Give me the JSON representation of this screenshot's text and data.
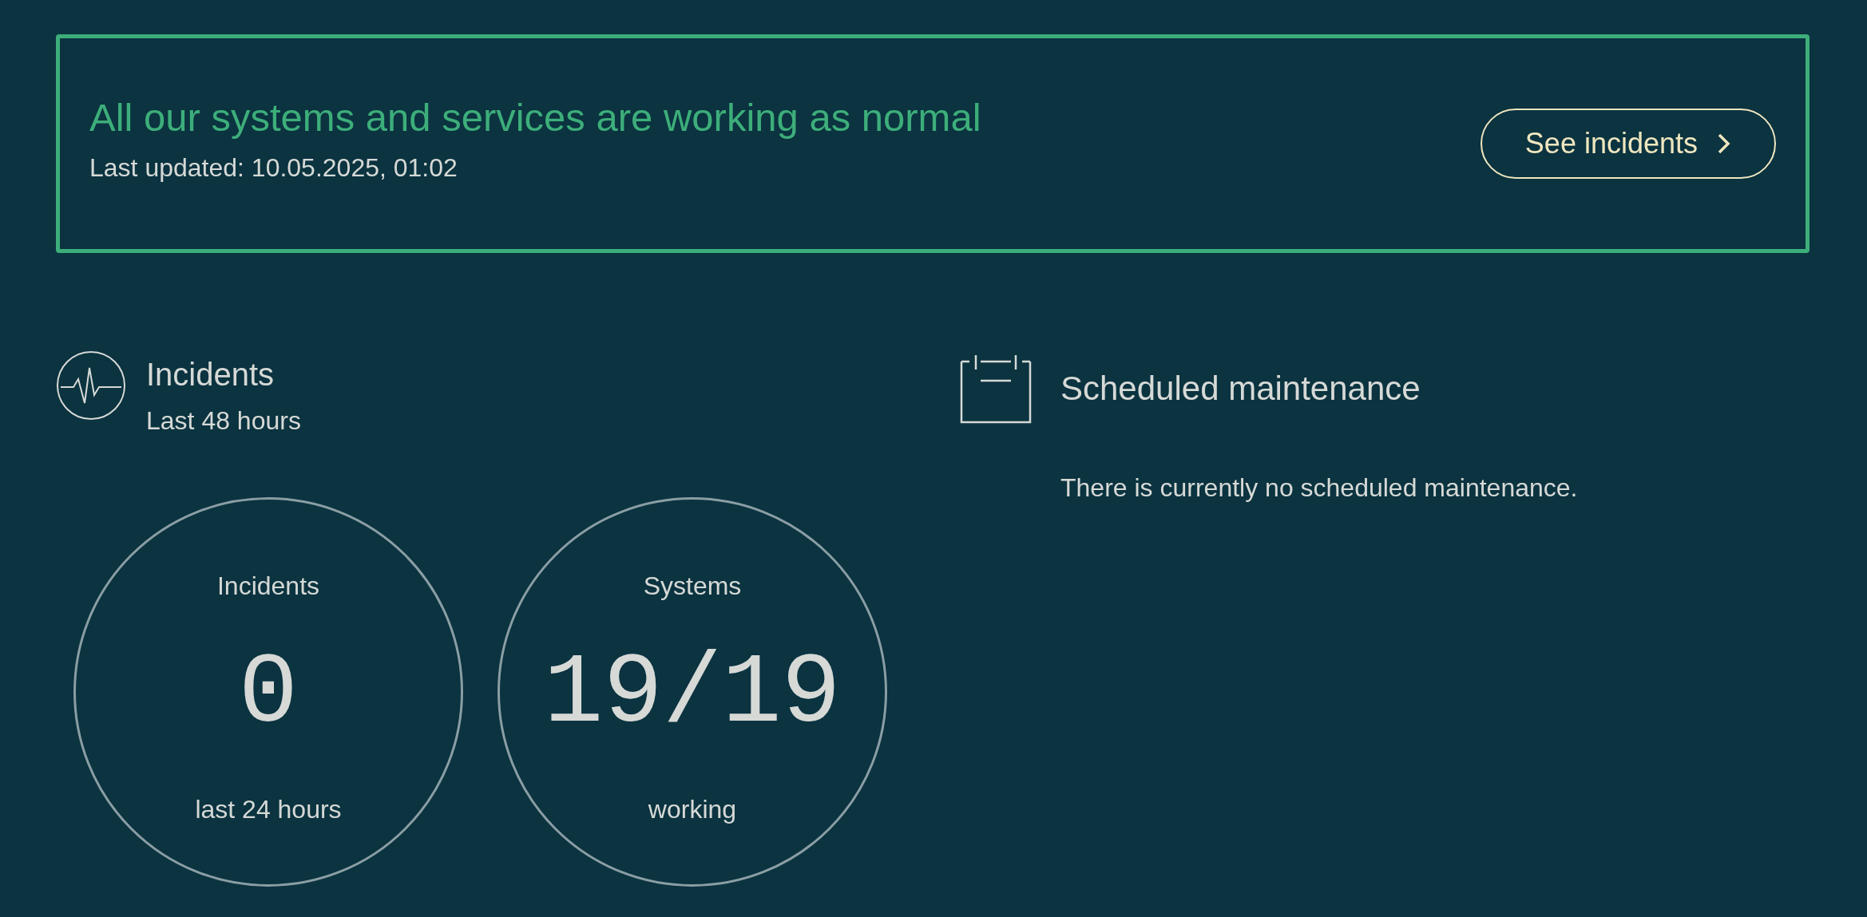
{
  "status_banner": {
    "title": "All our systems and services are working as normal",
    "last_updated": "Last updated: 10.05.2025, 01:02",
    "button": "See incidents"
  },
  "incidents": {
    "title": "Incidents",
    "subtitle": "Last 48 hours",
    "stats": [
      {
        "label": "Incidents",
        "value": "0",
        "caption": "last 24 hours"
      },
      {
        "label": "Systems",
        "value": "19/19",
        "caption": "working"
      }
    ]
  },
  "maintenance": {
    "title": "Scheduled maintenance",
    "message": "There is currently no scheduled maintenance."
  }
}
